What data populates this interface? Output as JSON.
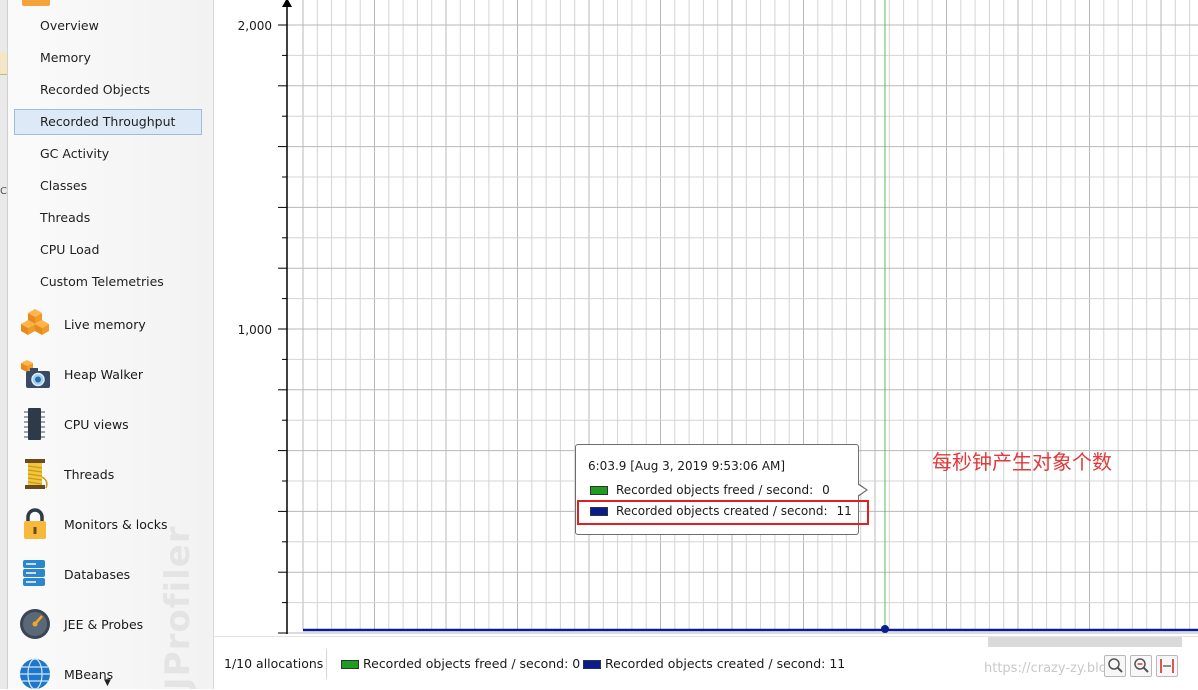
{
  "sidebar": {
    "sub_items": [
      {
        "label": "Overview"
      },
      {
        "label": "Memory"
      },
      {
        "label": "Recorded Objects"
      },
      {
        "label": "Recorded Throughput",
        "selected": true
      },
      {
        "label": "GC Activity"
      },
      {
        "label": "Classes"
      },
      {
        "label": "Threads"
      },
      {
        "label": "CPU Load"
      },
      {
        "label": "Custom Telemetries"
      }
    ],
    "categories": [
      {
        "label": "Live memory",
        "icon": "live-memory-icon"
      },
      {
        "label": "Heap Walker",
        "icon": "heap-walker-icon"
      },
      {
        "label": "CPU views",
        "icon": "cpu-views-icon"
      },
      {
        "label": "Threads",
        "icon": "threads-icon"
      },
      {
        "label": "Monitors & locks",
        "icon": "lock-icon"
      },
      {
        "label": "Databases",
        "icon": "database-icon"
      },
      {
        "label": "JEE & Probes",
        "icon": "gauge-icon"
      },
      {
        "label": "MBeans",
        "icon": "globe-icon"
      }
    ],
    "watermark": "JProfiler",
    "left_strip_char": "C"
  },
  "chart": {
    "y_ticks": [
      "2,000",
      "1,000"
    ],
    "colors": {
      "freed": "#1e9e1e",
      "created": "#0a1d8f",
      "cursor": "#5fb85f",
      "grid": "#c6c6c6"
    }
  },
  "tooltip": {
    "title": "6:03.9 [Aug 3, 2019 9:53:06 AM]",
    "rows": [
      {
        "label": "Recorded objects freed / second:",
        "value": "0"
      },
      {
        "label": "Recorded objects created / second:",
        "value": "11"
      }
    ]
  },
  "annotation": "每秒钟产生对象个数",
  "status_bar": {
    "allocations": "1/10 allocations",
    "legend_freed": "Recorded objects freed / second: 0",
    "legend_created": "Recorded objects created / second: 11",
    "url": "https://crazy-zy.blog..."
  }
}
